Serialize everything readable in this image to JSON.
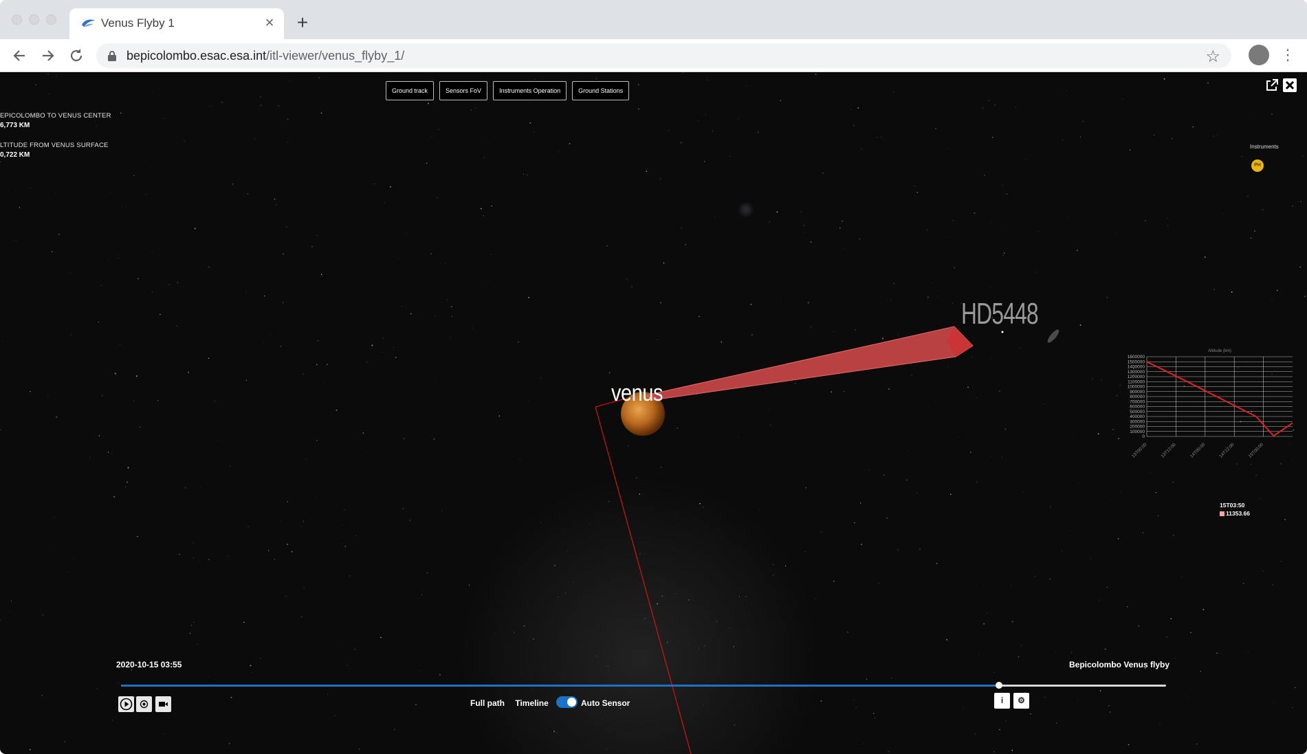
{
  "browser": {
    "tab_title": "Venus Flyby 1",
    "new_tab_symbol": "+",
    "url_host": "bepicolombo.esac.esa.int",
    "url_path": "/itl-viewer/venus_flyby_1/"
  },
  "layers": {
    "buttons": [
      "Ground track",
      "Sensors FoV",
      "Instruments Operation",
      "Ground Stations"
    ]
  },
  "stats": {
    "distance_label": "EPICOLOMBO TO VENUS CENTER",
    "distance_value": "6,773 KM",
    "altitude_label": "LTITUDE FROM VENUS SURFACE",
    "altitude_value": "0,722 KM"
  },
  "instruments": {
    "label": "Instruments",
    "badge": "PH",
    "badge_color": "#e7b516"
  },
  "scene": {
    "planet_label": "venus",
    "target_star_label": "HD5448"
  },
  "chart_data": {
    "type": "line",
    "title": "Altitude (km)",
    "y_ticks": [
      "1600000",
      "1500000",
      "1400000",
      "1300000",
      "1200000",
      "1100000",
      "1000000",
      "900000",
      "800000",
      "700000",
      "600000",
      "500000",
      "400000",
      "300000",
      "200000",
      "100000",
      "0"
    ],
    "x_ticks": [
      "13T00:00",
      "13T12:00",
      "14T00:00",
      "14T12:00",
      "15T00:00"
    ],
    "ylim": [
      0,
      1600000
    ],
    "series": [
      {
        "color": "#e32020",
        "points": [
          [
            0,
            1500000
          ],
          [
            0.25,
            1140000
          ],
          [
            0.5,
            770000
          ],
          [
            0.75,
            400000
          ],
          [
            0.87,
            11353.66
          ],
          [
            1,
            270000
          ]
        ]
      }
    ],
    "tooltip": {
      "time": "15T03:50",
      "value": "11353.66"
    }
  },
  "playback": {
    "timestamp": "2020-10-15 03:55",
    "mission_title": "Bepicolombo Venus flyby",
    "progress": 0.84,
    "full_path_label": "Full path",
    "timeline_label": "Timeline",
    "auto_sensor_label": "Auto Sensor",
    "auto_sensor_on": true,
    "accent_color": "#1a73c8"
  },
  "icons": {
    "back": "back-arrow-icon",
    "forward": "forward-arrow-icon",
    "reload": "reload-icon",
    "lock": "lock-icon",
    "bookmark": "star-icon",
    "play": "play-icon",
    "record": "record-icon",
    "camera": "video-camera-icon",
    "info": "info-icon",
    "settings": "gear-icon"
  }
}
